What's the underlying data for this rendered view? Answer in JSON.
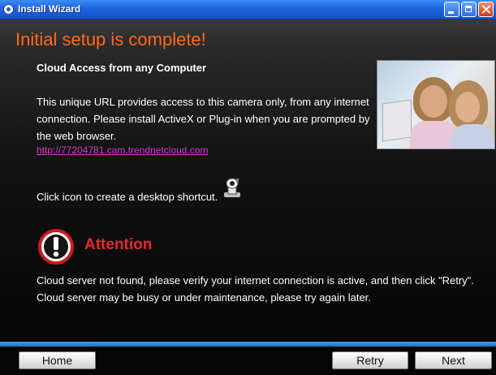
{
  "window": {
    "title": "Install Wizard"
  },
  "content": {
    "headline": "Initial setup is complete!",
    "subheading": "Cloud Access from any Computer",
    "description": "This unique URL provides access to this camera only, from any internet connection. Please install ActiveX or Plug-in when you are prompted by the web browser.",
    "cloud_url": "http://77204781.cam.trendnetcloud.com",
    "shortcut_prompt": "Click icon to create a desktop shortcut.",
    "attention_title": "Attention",
    "error_line1": "Cloud server not found, please verify your internet connection is active, and then click \"Retry\".",
    "error_line2": "Cloud server may be busy or under maintenance, please try again later."
  },
  "footer": {
    "home_label": "Home",
    "retry_label": "Retry",
    "next_label": "Next"
  },
  "colors": {
    "headline": "#ff6a1a",
    "attention": "#e8282e",
    "link": "#d13bd1",
    "accent_bar": "#2f88d8"
  }
}
